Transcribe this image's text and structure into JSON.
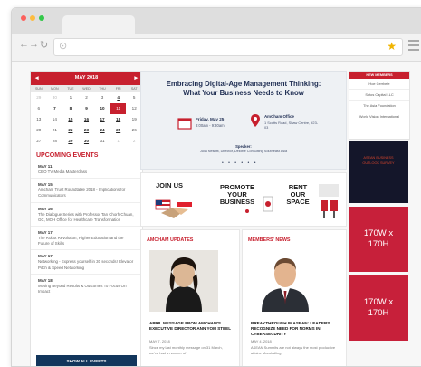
{
  "calendar": {
    "month_label": "MAY 2018",
    "day_labels": [
      "SUN",
      "MON",
      "TUE",
      "WED",
      "THU",
      "FRI",
      "SAT"
    ],
    "days": [
      [
        "29",
        "30",
        "1",
        "2",
        "3",
        "4",
        "5"
      ],
      [
        "6",
        "7",
        "8",
        "9",
        "10",
        "11",
        "12"
      ],
      [
        "13",
        "14",
        "15",
        "16",
        "17",
        "18",
        "19"
      ],
      [
        "20",
        "21",
        "22",
        "23",
        "24",
        "25",
        "26"
      ],
      [
        "27",
        "28",
        "29",
        "30",
        "31",
        "1",
        "2"
      ]
    ]
  },
  "events": {
    "heading": "UPCOMING EVENTS",
    "items": [
      {
        "date": "MAY 11",
        "title": "CEO TV Media Masterclass"
      },
      {
        "date": "MAY 15",
        "title": "Amcham Trust Roundtable 2018 - Implications for Communicators"
      },
      {
        "date": "MAY 16",
        "title": "The Dialogue Series with Professor Tan Chorh Chuan, GC, MOH Office for Healthcare Transformation"
      },
      {
        "date": "MAY 17",
        "title": "The Robot Revolution, Higher Education and the Future of Skills"
      },
      {
        "date": "MAY 17",
        "title": "Networking - Express yourself in 30 seconds! Elevator Pitch & Speed Networking"
      },
      {
        "date": "MAY 18",
        "title": "Moving Beyond Results & Outcomes To Focus On Impact"
      }
    ],
    "show_all": "SHOW ALL EVENTS"
  },
  "banner": {
    "title_line1": "Embracing Digital-Age Management Thinking:",
    "title_line2": "What Your Business Needs to Know",
    "date_text": "Friday, May 25",
    "time_text": "8:00am - 9:30am",
    "venue_text": "AmCham Office",
    "address_text": "1 Scotts Road, Shaw Centre, #23-03",
    "speaker_label": "Speaker:",
    "speaker_text": "Julia Nesbitt, Director, Deloitte Consulting Southeast Asia",
    "slide_dots": "• • • • • •"
  },
  "promos": [
    {
      "label_line1": "JOIN US",
      "label_line2": "",
      "label_line3": ""
    },
    {
      "label_line1": "PROMOTE",
      "label_line2": "YOUR",
      "label_line3": "BUSINESS"
    },
    {
      "label_line1": "RENT",
      "label_line2": "OUR",
      "label_line3": "SPACE"
    }
  ],
  "news": [
    {
      "heading": "AMCHAM UPDATES",
      "title": "APRIL MESSAGE FROM AMCHAM'S EXECUTIVE DIRECTOR ANN YOM STEEL",
      "date": "MAY 7, 2018",
      "excerpt": "Since my last monthly message on 31 March, we've had a number of"
    },
    {
      "heading": "MEMBERS' NEWS",
      "title": "BREAKTHROUGH IN ASEAN: LEADERS RECOGNIZE NEED FOR NORMS IN CYBERSECURITY",
      "date": "MAY 4, 2018",
      "excerpt": "ASEAN Summits are not always the most productive affairs. Marshalling"
    }
  ],
  "new_members": {
    "heading": "NEW MEMBERS",
    "items": [
      "Hoe Cerrbele",
      "Sotos Capital LLC",
      "The Asia Foundation",
      "World Vision International"
    ],
    "feature_text": "ASEAN BUSINESS OUTLOOK SURVEY"
  },
  "ads": [
    {
      "line1": "170W x",
      "line2": "170H"
    },
    {
      "line1": "170W x",
      "line2": "170H"
    }
  ],
  "colors": {
    "brand_red": "#c7202e",
    "navy": "#12365c",
    "ad_red": "#c7203a"
  }
}
